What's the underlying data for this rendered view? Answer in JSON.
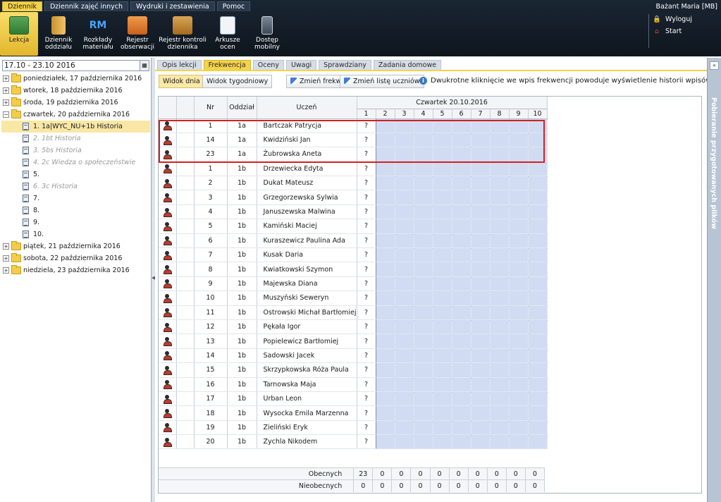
{
  "user": {
    "name": "Bażant Maria [MB]",
    "logout": "Wyloguj",
    "start": "Start"
  },
  "menu_tabs": [
    "Dziennik",
    "Dziennik zajęć innych",
    "Wydruki i zestawienia",
    "Pomoc"
  ],
  "ribbon": [
    {
      "label": "Lekcja",
      "icon": "lesson-icon"
    },
    {
      "label": "Dziennik oddziału",
      "icon": "class-journal-icon"
    },
    {
      "label": "Rozkłady materiału",
      "icon": "rm-icon"
    },
    {
      "label": "Rejestr obserwacji",
      "icon": "observation-icon"
    },
    {
      "label": "Rejestr kontroli dziennika",
      "icon": "control-icon"
    },
    {
      "label": "Arkusze ocen",
      "icon": "grades-sheet-icon"
    },
    {
      "label": "Dostęp mobilny",
      "icon": "mobile-icon"
    }
  ],
  "date_range": "17.10 - 23.10 2016",
  "tree": {
    "days_before": [
      "poniedziałek, 17 października 2016",
      "wtorek, 18 października 2016",
      "środa, 19 października 2016"
    ],
    "open_day": "czwartek, 20 października 2016",
    "lessons": [
      {
        "label": "1. 1a|WYC_NU+1b Historia",
        "state": "selected"
      },
      {
        "label": "2. 1bt Historia",
        "state": "dim"
      },
      {
        "label": "3. 5bs Historia",
        "state": "dim"
      },
      {
        "label": "4. 2c Wiedza o społeczeństwie",
        "state": "dim"
      },
      {
        "label": "5.",
        "state": "normal"
      },
      {
        "label": "6. 3c Historia",
        "state": "dim"
      },
      {
        "label": "7.",
        "state": "normal"
      },
      {
        "label": "8.",
        "state": "normal"
      },
      {
        "label": "9.",
        "state": "normal"
      },
      {
        "label": "10.",
        "state": "normal"
      }
    ],
    "days_after": [
      "piątek, 21 października 2016",
      "sobota, 22 października 2016",
      "niedziela, 23 października 2016"
    ]
  },
  "main_tabs": [
    "Opis lekcji",
    "Frekwencja",
    "Oceny",
    "Uwagi",
    "Sprawdziany",
    "Zadania domowe"
  ],
  "toolbar": {
    "day_view": "Widok dnia",
    "week_view": "Widok tygodniowy",
    "change_attendance": "Zmień frekwencję",
    "change_students": "Zmień listę uczniów",
    "note": "Dwukrotne kliknięcie we wpis frekwencji powoduje wyświetlenie historii wpisów"
  },
  "grid": {
    "col_nr": "Nr",
    "col_class": "Oddział",
    "col_student": "Uczeń",
    "day_header": "Czwartek 20.10.2016",
    "lesson_numbers": [
      "1",
      "2",
      "3",
      "4",
      "5",
      "6",
      "7",
      "8",
      "9",
      "10"
    ],
    "rows": [
      {
        "nr": "1",
        "class": "1a",
        "name": "Bartczak Patrycja",
        "status": "?"
      },
      {
        "nr": "14",
        "class": "1a",
        "name": "Kwidziński Jan",
        "status": "?"
      },
      {
        "nr": "23",
        "class": "1a",
        "name": "Żubrowska Aneta",
        "status": "?"
      },
      {
        "nr": "1",
        "class": "1b",
        "name": "Drzewiecka Edyta",
        "status": "?"
      },
      {
        "nr": "2",
        "class": "1b",
        "name": "Dukat Mateusz",
        "status": "?"
      },
      {
        "nr": "3",
        "class": "1b",
        "name": "Grzegorzewska Sylwia",
        "status": "?"
      },
      {
        "nr": "4",
        "class": "1b",
        "name": "Januszewska Malwina",
        "status": "?"
      },
      {
        "nr": "5",
        "class": "1b",
        "name": "Kamiński Maciej",
        "status": "?"
      },
      {
        "nr": "6",
        "class": "1b",
        "name": "Kuraszewicz Paulina Ada",
        "status": "?"
      },
      {
        "nr": "7",
        "class": "1b",
        "name": "Kusak Daria",
        "status": "?"
      },
      {
        "nr": "8",
        "class": "1b",
        "name": "Kwiatkowski Szymon",
        "status": "?"
      },
      {
        "nr": "9",
        "class": "1b",
        "name": "Majewska Diana",
        "status": "?"
      },
      {
        "nr": "10",
        "class": "1b",
        "name": "Muszyński Seweryn",
        "status": "?"
      },
      {
        "nr": "11",
        "class": "1b",
        "name": "Ostrowski Michał Bartłomiej",
        "status": "?"
      },
      {
        "nr": "12",
        "class": "1b",
        "name": "Pękała Igor",
        "status": "?"
      },
      {
        "nr": "13",
        "class": "1b",
        "name": "Popielewicz Bartłomiej",
        "status": "?"
      },
      {
        "nr": "14",
        "class": "1b",
        "name": "Sadowski Jacek",
        "status": "?"
      },
      {
        "nr": "15",
        "class": "1b",
        "name": "Skrzypkowska Róża Paula",
        "status": "?"
      },
      {
        "nr": "16",
        "class": "1b",
        "name": "Tarnowska Maja",
        "status": "?"
      },
      {
        "nr": "17",
        "class": "1b",
        "name": "Urban Leon",
        "status": "?"
      },
      {
        "nr": "18",
        "class": "1b",
        "name": "Wysocka Emila Marzenna",
        "status": "?"
      },
      {
        "nr": "19",
        "class": "1b",
        "name": "Zieliński Eryk",
        "status": "?"
      },
      {
        "nr": "20",
        "class": "1b",
        "name": "Zychla Nikodem",
        "status": "?"
      }
    ],
    "totals": {
      "present_label": "Obecnych",
      "present": [
        "23",
        "0",
        "0",
        "0",
        "0",
        "0",
        "0",
        "0",
        "0",
        "0"
      ],
      "absent_label": "Nieobecnych",
      "absent": [
        "0",
        "0",
        "0",
        "0",
        "0",
        "0",
        "0",
        "0",
        "0",
        "0"
      ]
    }
  },
  "right_panel": {
    "label": "Pobieranie przygotowanych plików"
  },
  "colors": {
    "accent": "#f4d24a",
    "topbar": "#141e29",
    "slot": "#d1dcf2",
    "highlight": "#d32020"
  }
}
